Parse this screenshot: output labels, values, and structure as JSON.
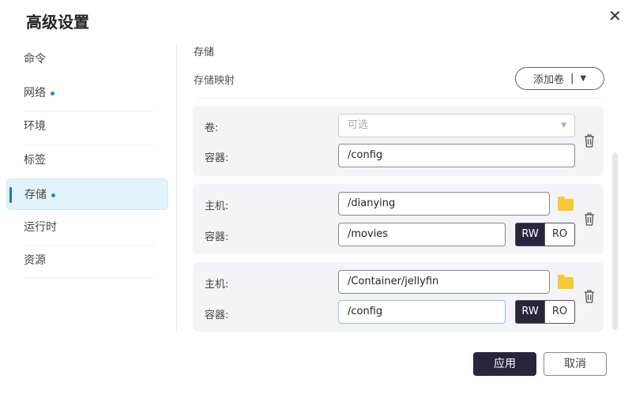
{
  "dialog": {
    "title": "高级设置",
    "close_icon": "close-icon"
  },
  "sidebar": {
    "items": [
      {
        "label": "命令",
        "dot": false
      },
      {
        "label": "网络",
        "dot": true
      },
      {
        "label": "环境",
        "dot": false
      },
      {
        "label": "标签",
        "dot": false
      },
      {
        "label": "存储",
        "dot": true,
        "active": true
      },
      {
        "label": "运行时",
        "dot": false
      },
      {
        "label": "资源",
        "dot": false
      }
    ]
  },
  "main": {
    "section_title": "存储",
    "subsection_title": "存储映射",
    "add_button": "添加卷",
    "cards": [
      {
        "label1": "卷:",
        "value1": "",
        "placeholder1": "可选",
        "label2": "容器:",
        "value2": "/config"
      },
      {
        "label1": "主机:",
        "value1": "/dianying",
        "label2": "容器:",
        "value2": "/movies",
        "rw": "RW",
        "ro": "RO",
        "mode": "RW"
      },
      {
        "label1": "主机:",
        "value1": "/Container/jellyfin",
        "label2": "容器:",
        "value2": "/config",
        "rw": "RW",
        "ro": "RO",
        "mode": "RW"
      }
    ]
  },
  "footer": {
    "apply": "应用",
    "cancel": "取消"
  },
  "colors": {
    "accent": "#27263c",
    "active_bg": "#e3f3fb",
    "dot": "#1e8ad2",
    "folder": "#f6c936"
  }
}
